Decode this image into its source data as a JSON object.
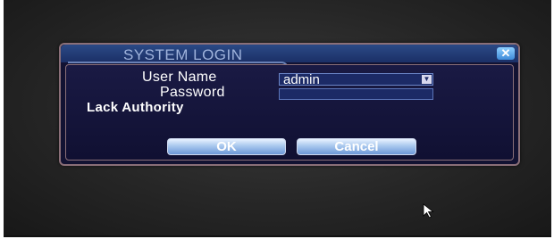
{
  "dialog": {
    "title": "SYSTEM LOGIN",
    "close_glyph": "✕"
  },
  "form": {
    "user_name_label": "User Name",
    "user_name_value": "admin",
    "password_label": "Password",
    "password_value": "",
    "status_message": "Lack Authority"
  },
  "buttons": {
    "ok_label": "OK",
    "cancel_label": "Cancel"
  },
  "icons": {
    "dropdown": "chevron-down-icon",
    "close": "close-icon",
    "cursor": "mouse-pointer-icon"
  },
  "colors": {
    "dialog_background": "#121232",
    "title_text": "#9fb3dc",
    "button_gradient_top": "#e8f2ff",
    "button_gradient_bottom": "#6c98d8"
  }
}
